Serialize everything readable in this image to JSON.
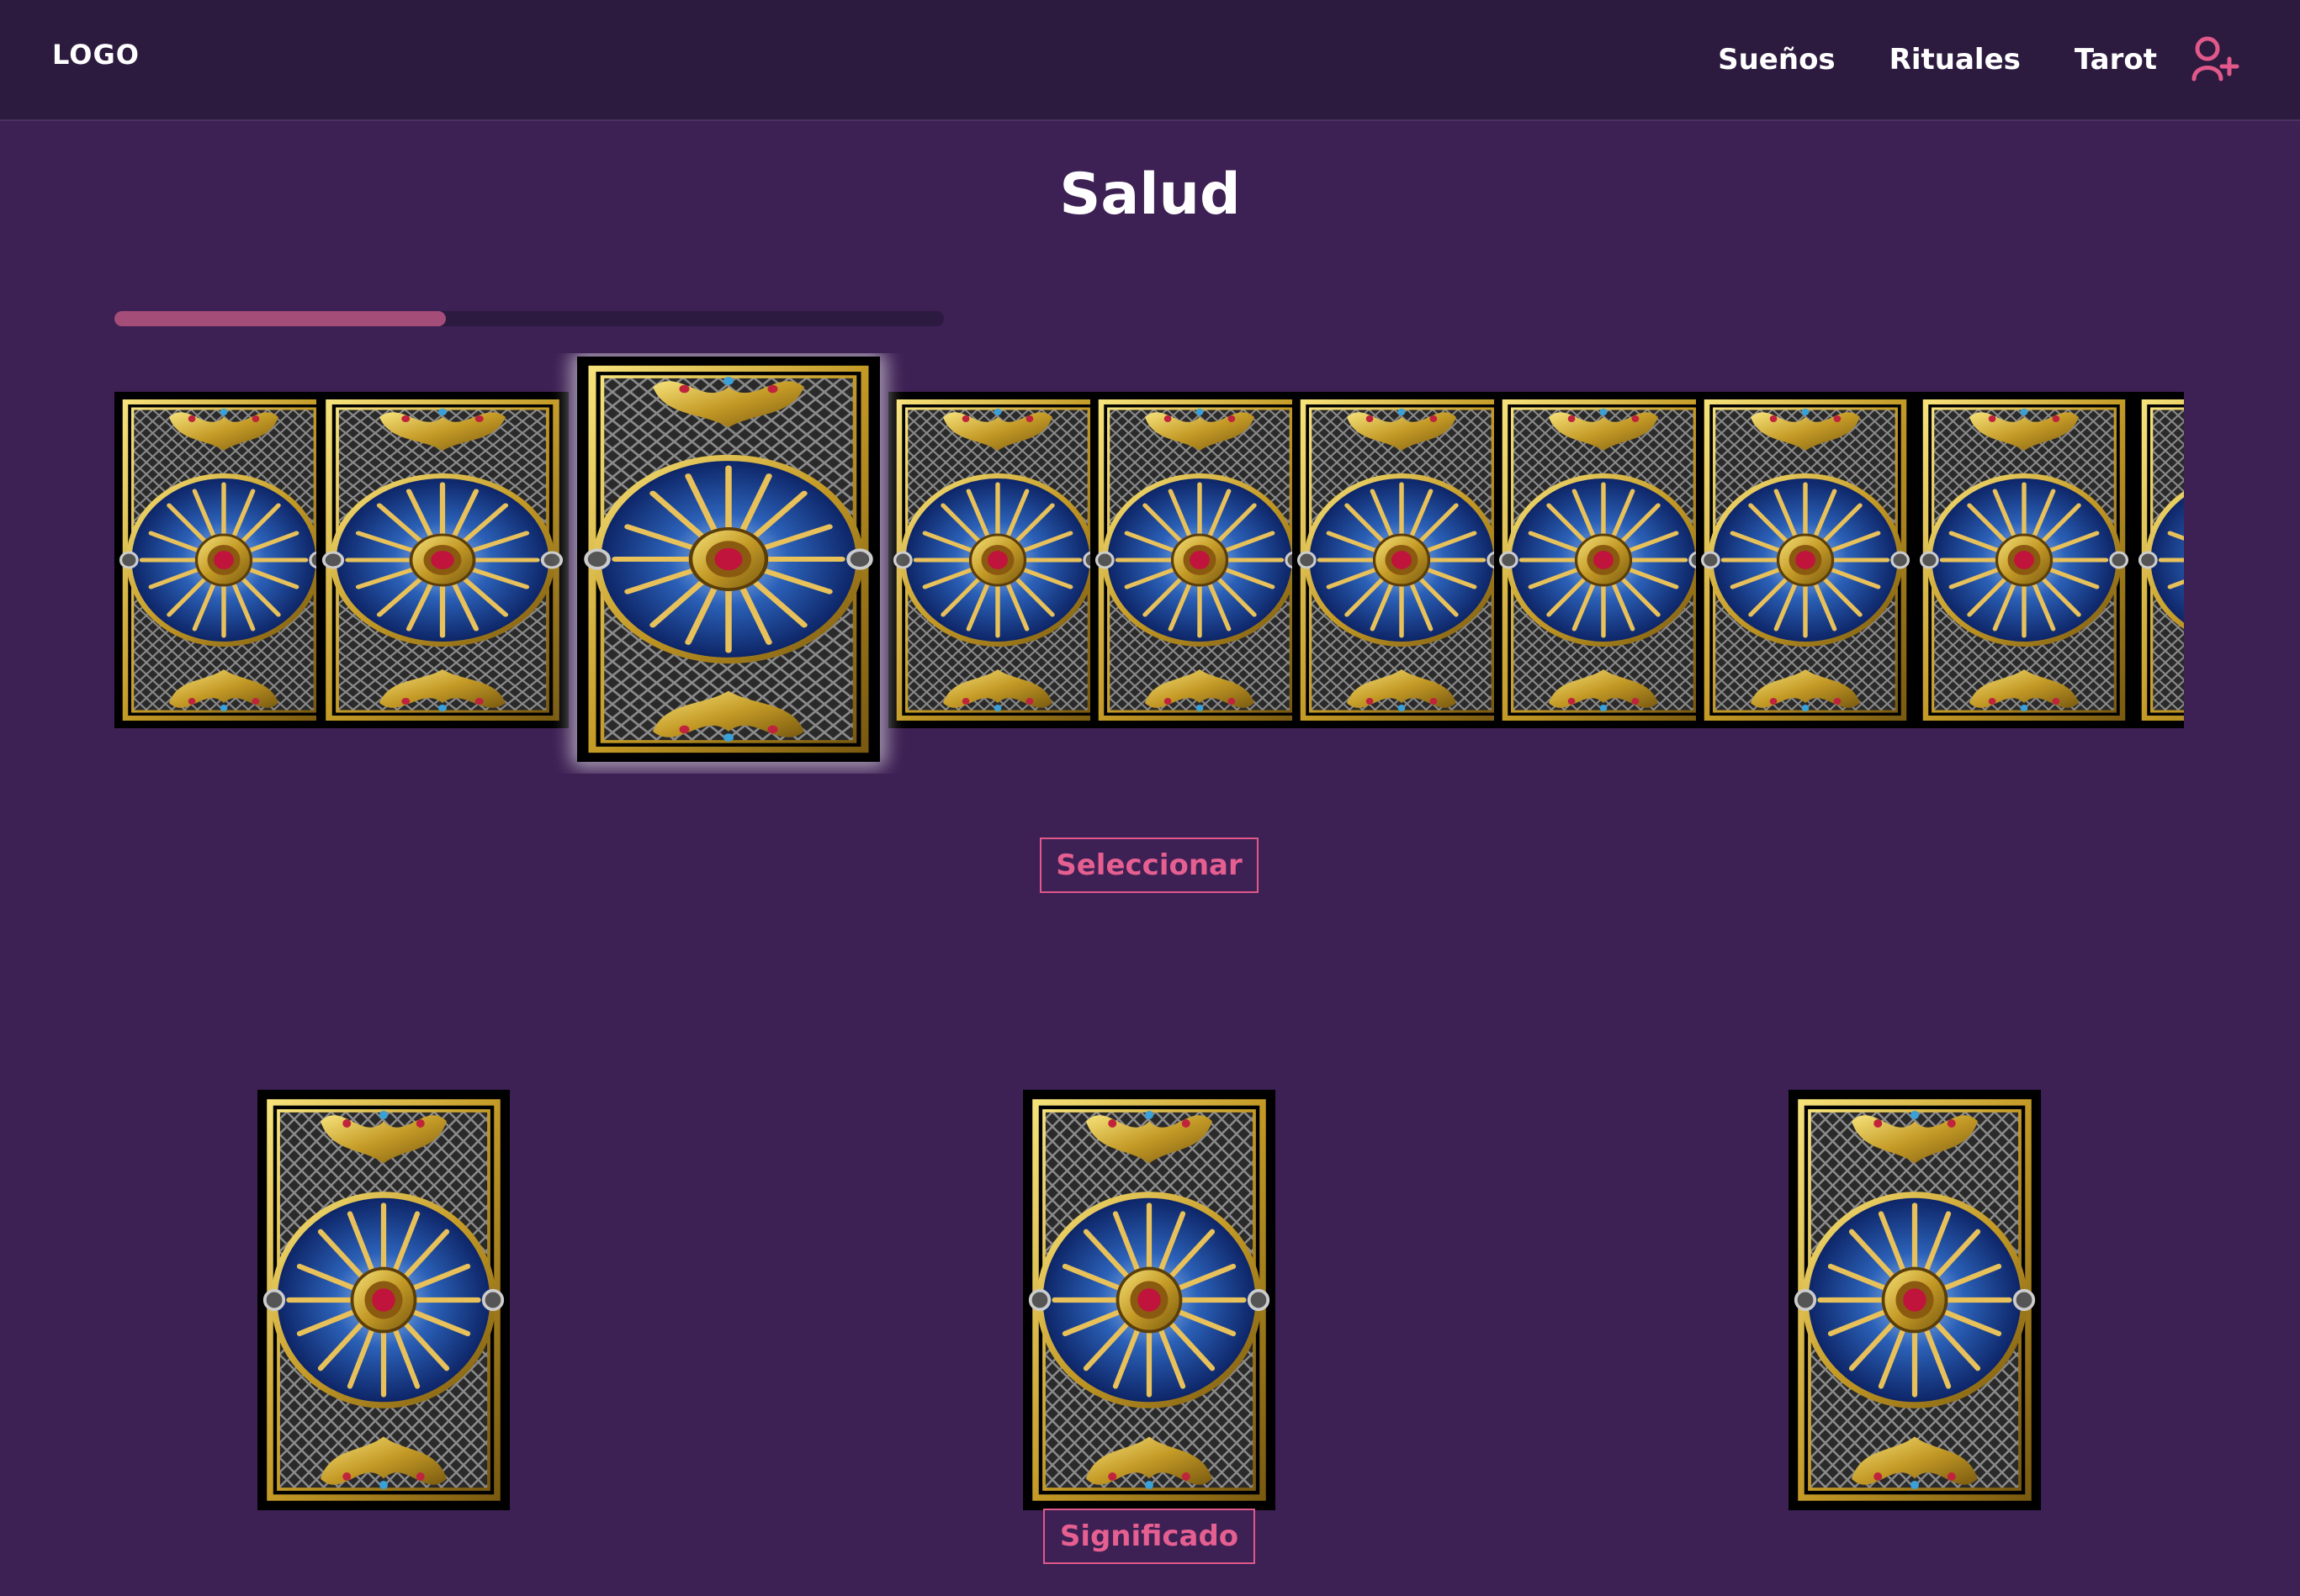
{
  "navbar": {
    "logo": "LOGO",
    "links": [
      "Sueños",
      "Rituales",
      "Tarot"
    ],
    "user_icon": "user-add-icon",
    "accent_color": "#e0598a"
  },
  "page": {
    "title": "Salud"
  },
  "progress": {
    "fraction": 0.4
  },
  "deck": {
    "card_count": 10,
    "selected_index": 2,
    "card_back_icon": "tarot-card-back"
  },
  "actions": {
    "select_label": "Seleccionar",
    "meaning_label": "Significado"
  },
  "spread": {
    "slots": 3
  },
  "colors": {
    "background": "#3d2054",
    "navbar": "#2c1b3f",
    "progress": "#a44d78",
    "button_text": "#e65f91"
  }
}
